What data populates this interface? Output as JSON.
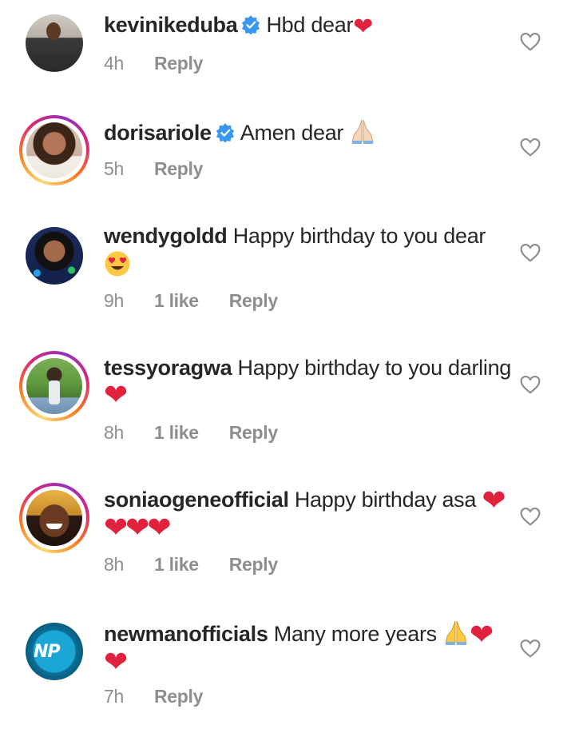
{
  "comments": [
    {
      "username": "kevinikeduba",
      "verified": true,
      "text": "Hbd dear",
      "emoji_suffix": "heart-icon",
      "time": "4h",
      "likes": "",
      "reply_label": "Reply"
    },
    {
      "username": "dorisariole",
      "verified": true,
      "text": "Amen dear",
      "emoji_suffix": "praying-hands-icon",
      "time": "5h",
      "likes": "",
      "reply_label": "Reply"
    },
    {
      "username": "wendygoldd",
      "verified": false,
      "text": "Happy birthday to you dear",
      "emoji_suffix": "heart-eyes-icon",
      "time": "9h",
      "likes": "1 like",
      "reply_label": "Reply"
    },
    {
      "username": "tessyoragwa",
      "verified": false,
      "text": "Happy birthday to you darling",
      "emoji_suffix": "heart-icon",
      "time": "8h",
      "likes": "1 like",
      "reply_label": "Reply"
    },
    {
      "username": "soniaogeneofficial",
      "verified": false,
      "text": "Happy birthday asa",
      "emoji_suffix": "heart-icon",
      "time": "8h",
      "likes": "1 like",
      "reply_label": "Reply"
    },
    {
      "username": "newmanofficials",
      "verified": false,
      "text": "Many more years",
      "emoji_suffix": "praying-hands-icon",
      "time": "7h",
      "likes": "",
      "reply_label": "Reply"
    }
  ],
  "avatar_logo_text": "NP",
  "colors": {
    "text": "#262626",
    "meta": "#8e8e8e",
    "verified": "#3897f0",
    "heart": "#e0223c"
  }
}
